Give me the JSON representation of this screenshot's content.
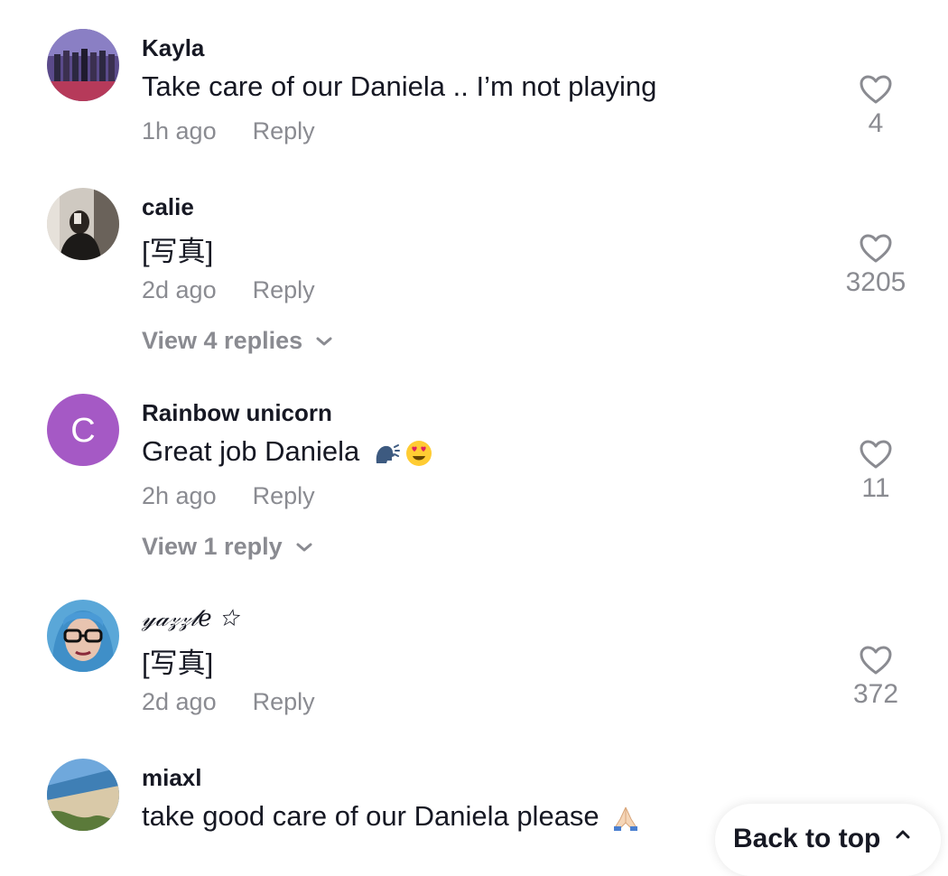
{
  "comments": [
    {
      "username": "Kayla",
      "text": "Take care of our Daniela .. I’m not playing",
      "time": "1h ago",
      "reply_label": "Reply",
      "likes": "4",
      "avatar": "group-stage-photo"
    },
    {
      "username": "calie",
      "text": "[写真]",
      "time": "2d ago",
      "reply_label": "Reply",
      "likes": "3205",
      "view_replies": "View 4 replies",
      "avatar": "mirror-selfie-photo"
    },
    {
      "username": "Rainbow unicorn",
      "text": "Great job Daniela",
      "time": "2h ago",
      "reply_label": "Reply",
      "likes": "11",
      "view_replies": "View 1 reply",
      "avatar_initial": "C",
      "avatar_color": "#a559c5"
    },
    {
      "username": "𝓎𝒶𝓏𝓏𝓁𝑒 ☆",
      "text": "[写真]",
      "time": "2d ago",
      "reply_label": "Reply",
      "likes": "372",
      "avatar": "blue-hair-glasses-photo"
    },
    {
      "username": "miaxl",
      "text": "take good care of our Daniela please",
      "avatar": "beach-photo"
    }
  ],
  "back_to_top": "Back to top",
  "colors": {
    "text": "#161823",
    "muted": "#8a8b91",
    "avatar_purple": "#a559c5"
  }
}
